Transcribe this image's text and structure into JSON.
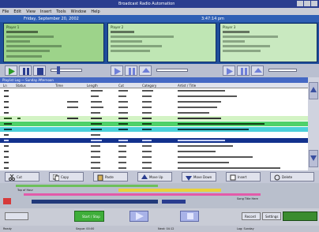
{
  "window": {
    "title": "Broadcast Radio Automation"
  },
  "menu": [
    "File",
    "Edit",
    "View",
    "Insert",
    "Tools",
    "Window",
    "Help"
  ],
  "players": {
    "date": "Friday, September 20, 2002",
    "clock": "3:47:14 pm",
    "decks": [
      {
        "tag": "Player 1"
      },
      {
        "tag": "Player 2"
      },
      {
        "tag": "Player 3"
      }
    ]
  },
  "playlist": {
    "header": "Playlist Log — Sunday Afternoon",
    "columns": [
      "Ln",
      "Status",
      "Time",
      "Length",
      "Cut",
      "Category",
      "Artist / Title"
    ]
  },
  "actions": [
    "Cut",
    "Copy",
    "Paste",
    "Move Up",
    "Move Down",
    "Insert",
    "Delete"
  ],
  "timeline": {
    "segment": "Top of Hour",
    "right_label": "Song Title Here"
  },
  "bottom": {
    "go_label": "Start / Stop",
    "buttons": [
      "Record",
      "Settings"
    ]
  },
  "status": [
    "Ready",
    "Segue: 00:00",
    "Next: 04:12",
    "Log: Sunday"
  ],
  "colors": {
    "accent": "#2a3d8f",
    "highlight_green": "#4fd16a",
    "highlight_cyan": "#4bd0d9",
    "selected_row": "#12318d"
  }
}
